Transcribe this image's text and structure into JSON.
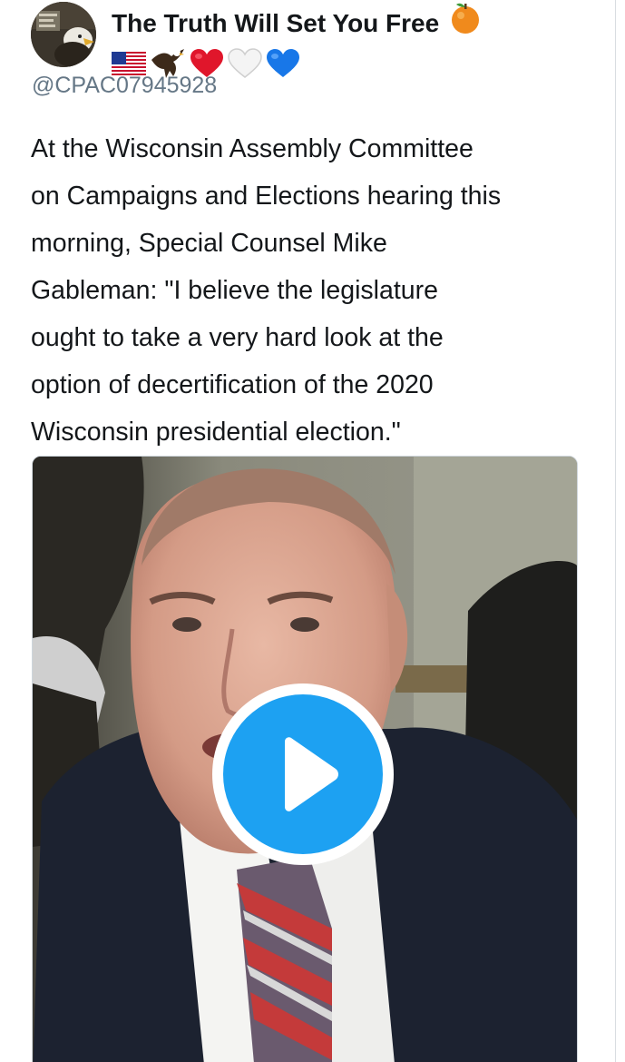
{
  "tweet": {
    "display_name": "The Truth Will Set You Free",
    "name_emojis": [
      "orange-emoji"
    ],
    "badge_emojis": [
      "us-flag-emoji",
      "eagle-emoji",
      "red-heart-emoji",
      "white-heart-emoji",
      "blue-heart-emoji"
    ],
    "handle": "@CPAC07945928",
    "text": "At the Wisconsin Assembly Committee\non Campaigns and Elections hearing this\nmorning, Special Counsel Mike\nGableman: \"I believe the legislature\nought to take a very hard look at the\noption of decertification of the 2020\nWisconsin presidential election.\"",
    "media": {
      "type": "video",
      "play_icon": "play-icon"
    }
  },
  "colors": {
    "accent": "#1da1f2",
    "handle": "#657786",
    "text": "#14171a"
  }
}
